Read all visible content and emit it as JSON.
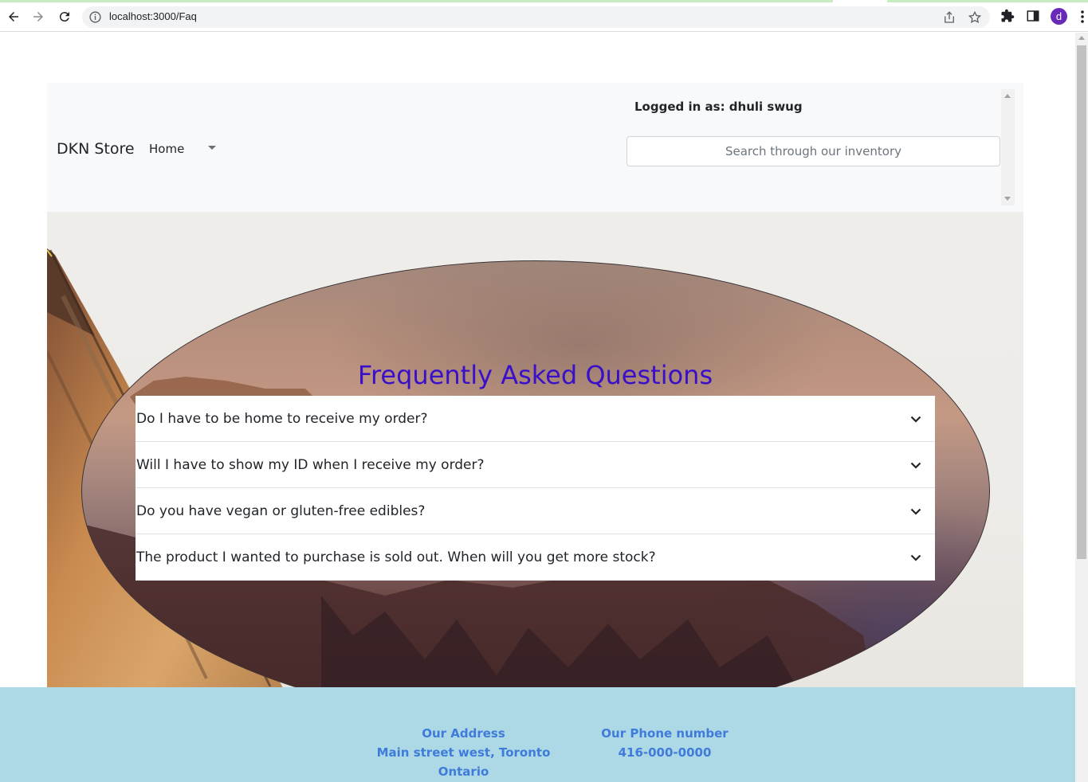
{
  "browser": {
    "url": "localhost:3000/Faq",
    "profile_initial": "d",
    "accent": "#6a2ab8"
  },
  "navbar": {
    "brand": "DKN Store",
    "home_label": "Home",
    "logged_in": "Logged in as: dhuli swug",
    "search_placeholder": "Search through our inventory"
  },
  "faq": {
    "title": "Frequently Asked Questions",
    "title_color": "#3a0fc9",
    "items": [
      {
        "question": "Do I have to be home to receive my order?"
      },
      {
        "question": "Will I have to show my ID when I receive my order?"
      },
      {
        "question": "Do you have vegan or gluten-free edibles?"
      },
      {
        "question": "The product I wanted to purchase is sold out. When will you get more stock?"
      }
    ]
  },
  "footer": {
    "address_heading": "Our Address",
    "address_value": "Main street west, Toronto Ontario",
    "phone_heading": "Our Phone number",
    "phone_value": "416-000-0000",
    "background": "#add8e6",
    "text_color": "#3f7bd9"
  }
}
